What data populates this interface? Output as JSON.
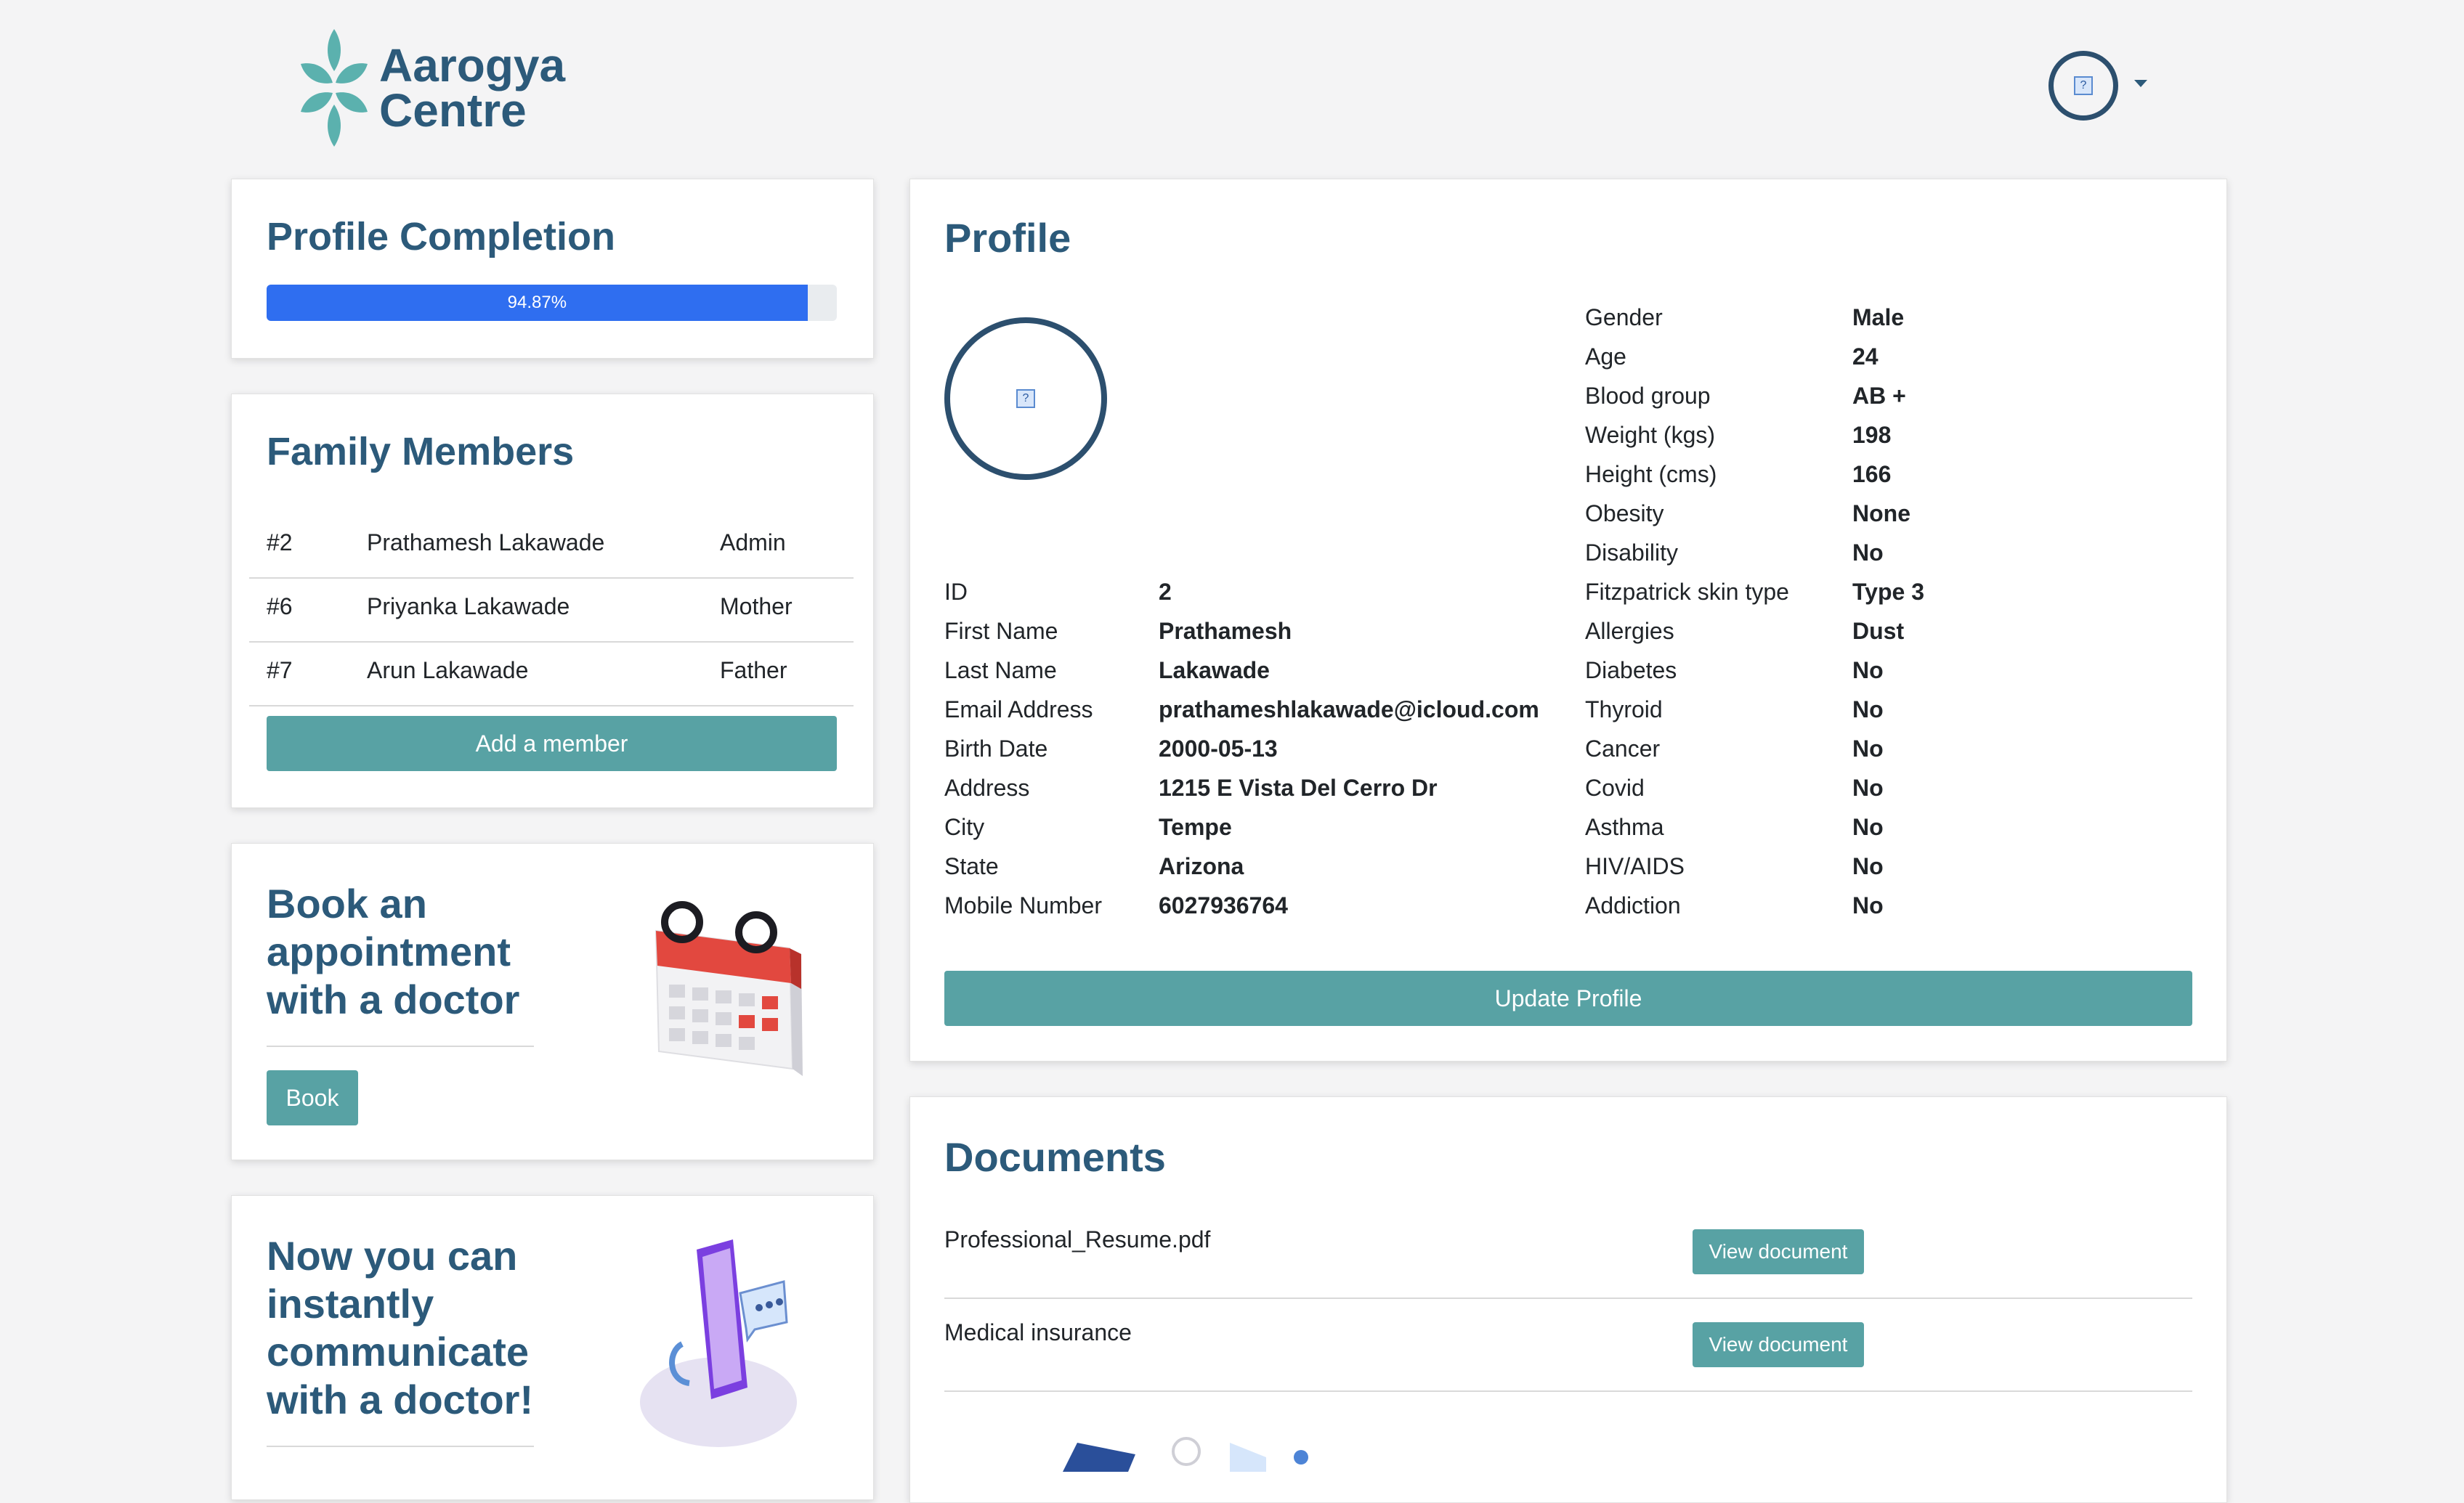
{
  "brand": {
    "line1": "Aarogya",
    "line2": "Centre"
  },
  "profile_completion": {
    "title": "Profile Completion",
    "percent_label": "94.87%",
    "fraction": 0.9487
  },
  "family": {
    "title": "Family Members",
    "members": [
      {
        "id": "#2",
        "name": "Prathamesh Lakawade",
        "relation": "Admin"
      },
      {
        "id": "#6",
        "name": "Priyanka Lakawade",
        "relation": "Mother"
      },
      {
        "id": "#7",
        "name": "Arun Lakawade",
        "relation": "Father"
      }
    ],
    "add_label": "Add a member"
  },
  "book": {
    "line1": "Book an",
    "line2": "appointment",
    "line3": "with a doctor",
    "button": "Book"
  },
  "chat": {
    "line1": "Now you can",
    "line2": "instantly",
    "line3": "communicate",
    "line4": "with a doctor!"
  },
  "profile": {
    "title": "Profile",
    "left": [
      {
        "k": "ID",
        "v": "2"
      },
      {
        "k": "First Name",
        "v": "Prathamesh"
      },
      {
        "k": "Last Name",
        "v": "Lakawade"
      },
      {
        "k": "Email Address",
        "v": "prathameshlakawade@icloud.com"
      },
      {
        "k": "Birth Date",
        "v": "2000-05-13"
      },
      {
        "k": "Address",
        "v": "1215 E Vista Del Cerro Dr"
      },
      {
        "k": "City",
        "v": "Tempe"
      },
      {
        "k": "State",
        "v": "Arizona"
      },
      {
        "k": "Mobile Number",
        "v": "6027936764"
      }
    ],
    "right": [
      {
        "k": "Gender",
        "v": "Male"
      },
      {
        "k": "Age",
        "v": "24"
      },
      {
        "k": "Blood group",
        "v": "AB +"
      },
      {
        "k": "Weight (kgs)",
        "v": "198"
      },
      {
        "k": "Height (cms)",
        "v": "166"
      },
      {
        "k": "Obesity",
        "v": "None"
      },
      {
        "k": "Disability",
        "v": "No"
      },
      {
        "k": "Fitzpatrick skin type",
        "v": "Type 3"
      },
      {
        "k": "Allergies",
        "v": "Dust"
      },
      {
        "k": "Diabetes",
        "v": "No"
      },
      {
        "k": "Thyroid",
        "v": "No"
      },
      {
        "k": "Cancer",
        "v": "No"
      },
      {
        "k": "Covid",
        "v": "No"
      },
      {
        "k": "Asthma",
        "v": "No"
      },
      {
        "k": "HIV/AIDS",
        "v": "No"
      },
      {
        "k": "Addiction",
        "v": "No"
      }
    ],
    "update_label": "Update Profile"
  },
  "documents": {
    "title": "Documents",
    "items": [
      {
        "name": "Professional_Resume.pdf",
        "button": "View document"
      },
      {
        "name": "Medical insurance",
        "button": "View document"
      }
    ]
  },
  "colors": {
    "accent": "#58a2a4",
    "heading": "#2c5a7a",
    "progress": "#2f6ef0"
  },
  "icons": {
    "logo": "leaf-flower-logo",
    "user_avatar": "broken-image-icon",
    "calendar": "calendar-illustration",
    "phone": "phone-chat-illustration"
  }
}
